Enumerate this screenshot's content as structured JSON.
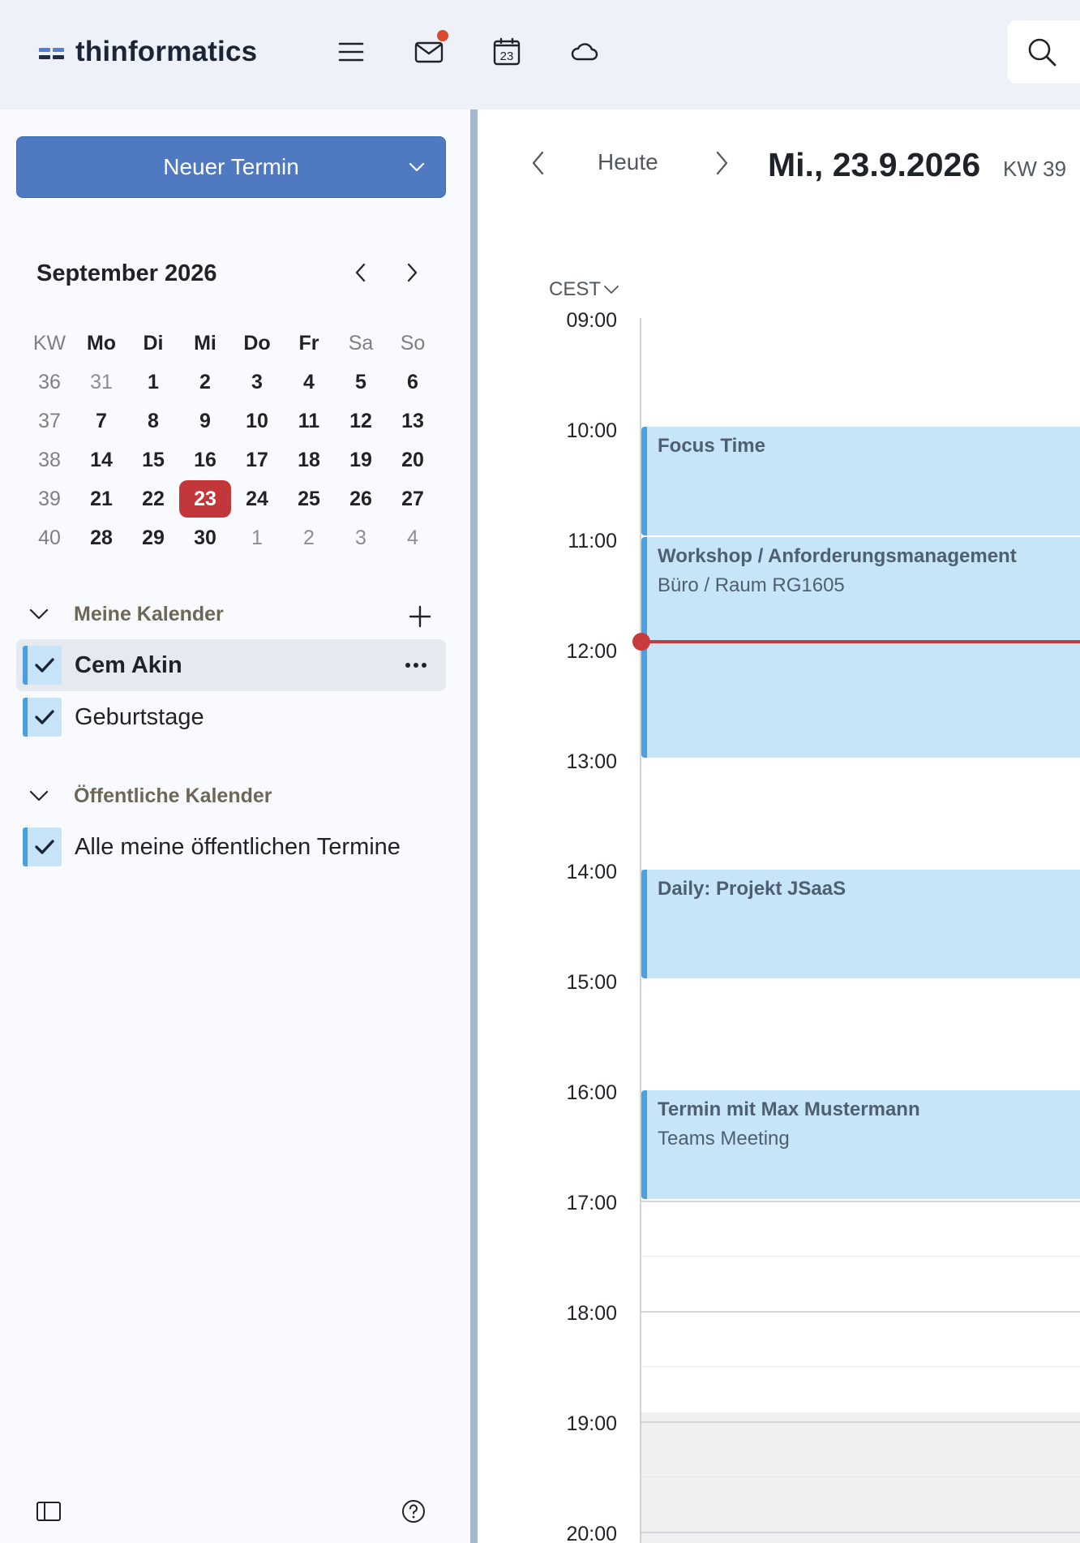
{
  "app": {
    "brand": "thinformatics"
  },
  "topbar": {
    "icons": [
      "menu-icon",
      "mail-icon",
      "calendar-icon",
      "cloud-icon",
      "search-icon"
    ],
    "calendar_day": "23",
    "mail_unread_dot": true,
    "accent": "#4f79c0"
  },
  "sidebar": {
    "new_button_label": "Neuer Termin",
    "mini_calendar": {
      "title": "September 2026",
      "headers": [
        "KW",
        "Mo",
        "Di",
        "Mi",
        "Do",
        "Fr",
        "Sa",
        "So"
      ],
      "weeks": [
        {
          "kw": "36",
          "days": [
            "31",
            "1",
            "2",
            "3",
            "4",
            "5",
            "6"
          ]
        },
        {
          "kw": "37",
          "days": [
            "7",
            "8",
            "9",
            "10",
            "11",
            "12",
            "13"
          ]
        },
        {
          "kw": "38",
          "days": [
            "14",
            "15",
            "16",
            "17",
            "18",
            "19",
            "20"
          ]
        },
        {
          "kw": "39",
          "days": [
            "21",
            "22",
            "23",
            "24",
            "25",
            "26",
            "27"
          ]
        },
        {
          "kw": "40",
          "days": [
            "28",
            "29",
            "30",
            "1",
            "2",
            "3",
            "4"
          ]
        }
      ],
      "today": "23",
      "today_color": "#c2373a"
    },
    "my_calendars": {
      "heading": "Meine Kalender",
      "items": [
        {
          "label": "Cem Akin",
          "checked": true,
          "selected": true
        },
        {
          "label": "Geburtstage",
          "checked": true,
          "selected": false
        }
      ]
    },
    "public_calendars": {
      "heading": "Öffentliche Kalender",
      "items": [
        {
          "label": "Alle meine öffentlichen Termine",
          "checked": true
        }
      ]
    }
  },
  "main": {
    "today_label": "Heute",
    "date_title": "Mi., 23.9.2026",
    "week_label": "KW 39",
    "timezone": "CEST",
    "hours": [
      "09:00",
      "10:00",
      "11:00",
      "12:00",
      "13:00",
      "14:00",
      "15:00",
      "16:00",
      "17:00",
      "18:00",
      "19:00",
      "20:00"
    ],
    "events": [
      {
        "title": "Focus Time",
        "subtitle": ""
      },
      {
        "title": "Workshop / Anforderungsmanagement",
        "subtitle": "Büro / Raum RG1605"
      },
      {
        "title": "Daily: Projekt JSaaS",
        "subtitle": ""
      },
      {
        "title": "Termin mit Max Mustermann",
        "subtitle": "Teams Meeting"
      }
    ],
    "now_indicator_color": "#c93a3d",
    "event_color": "#c6e5f8"
  }
}
